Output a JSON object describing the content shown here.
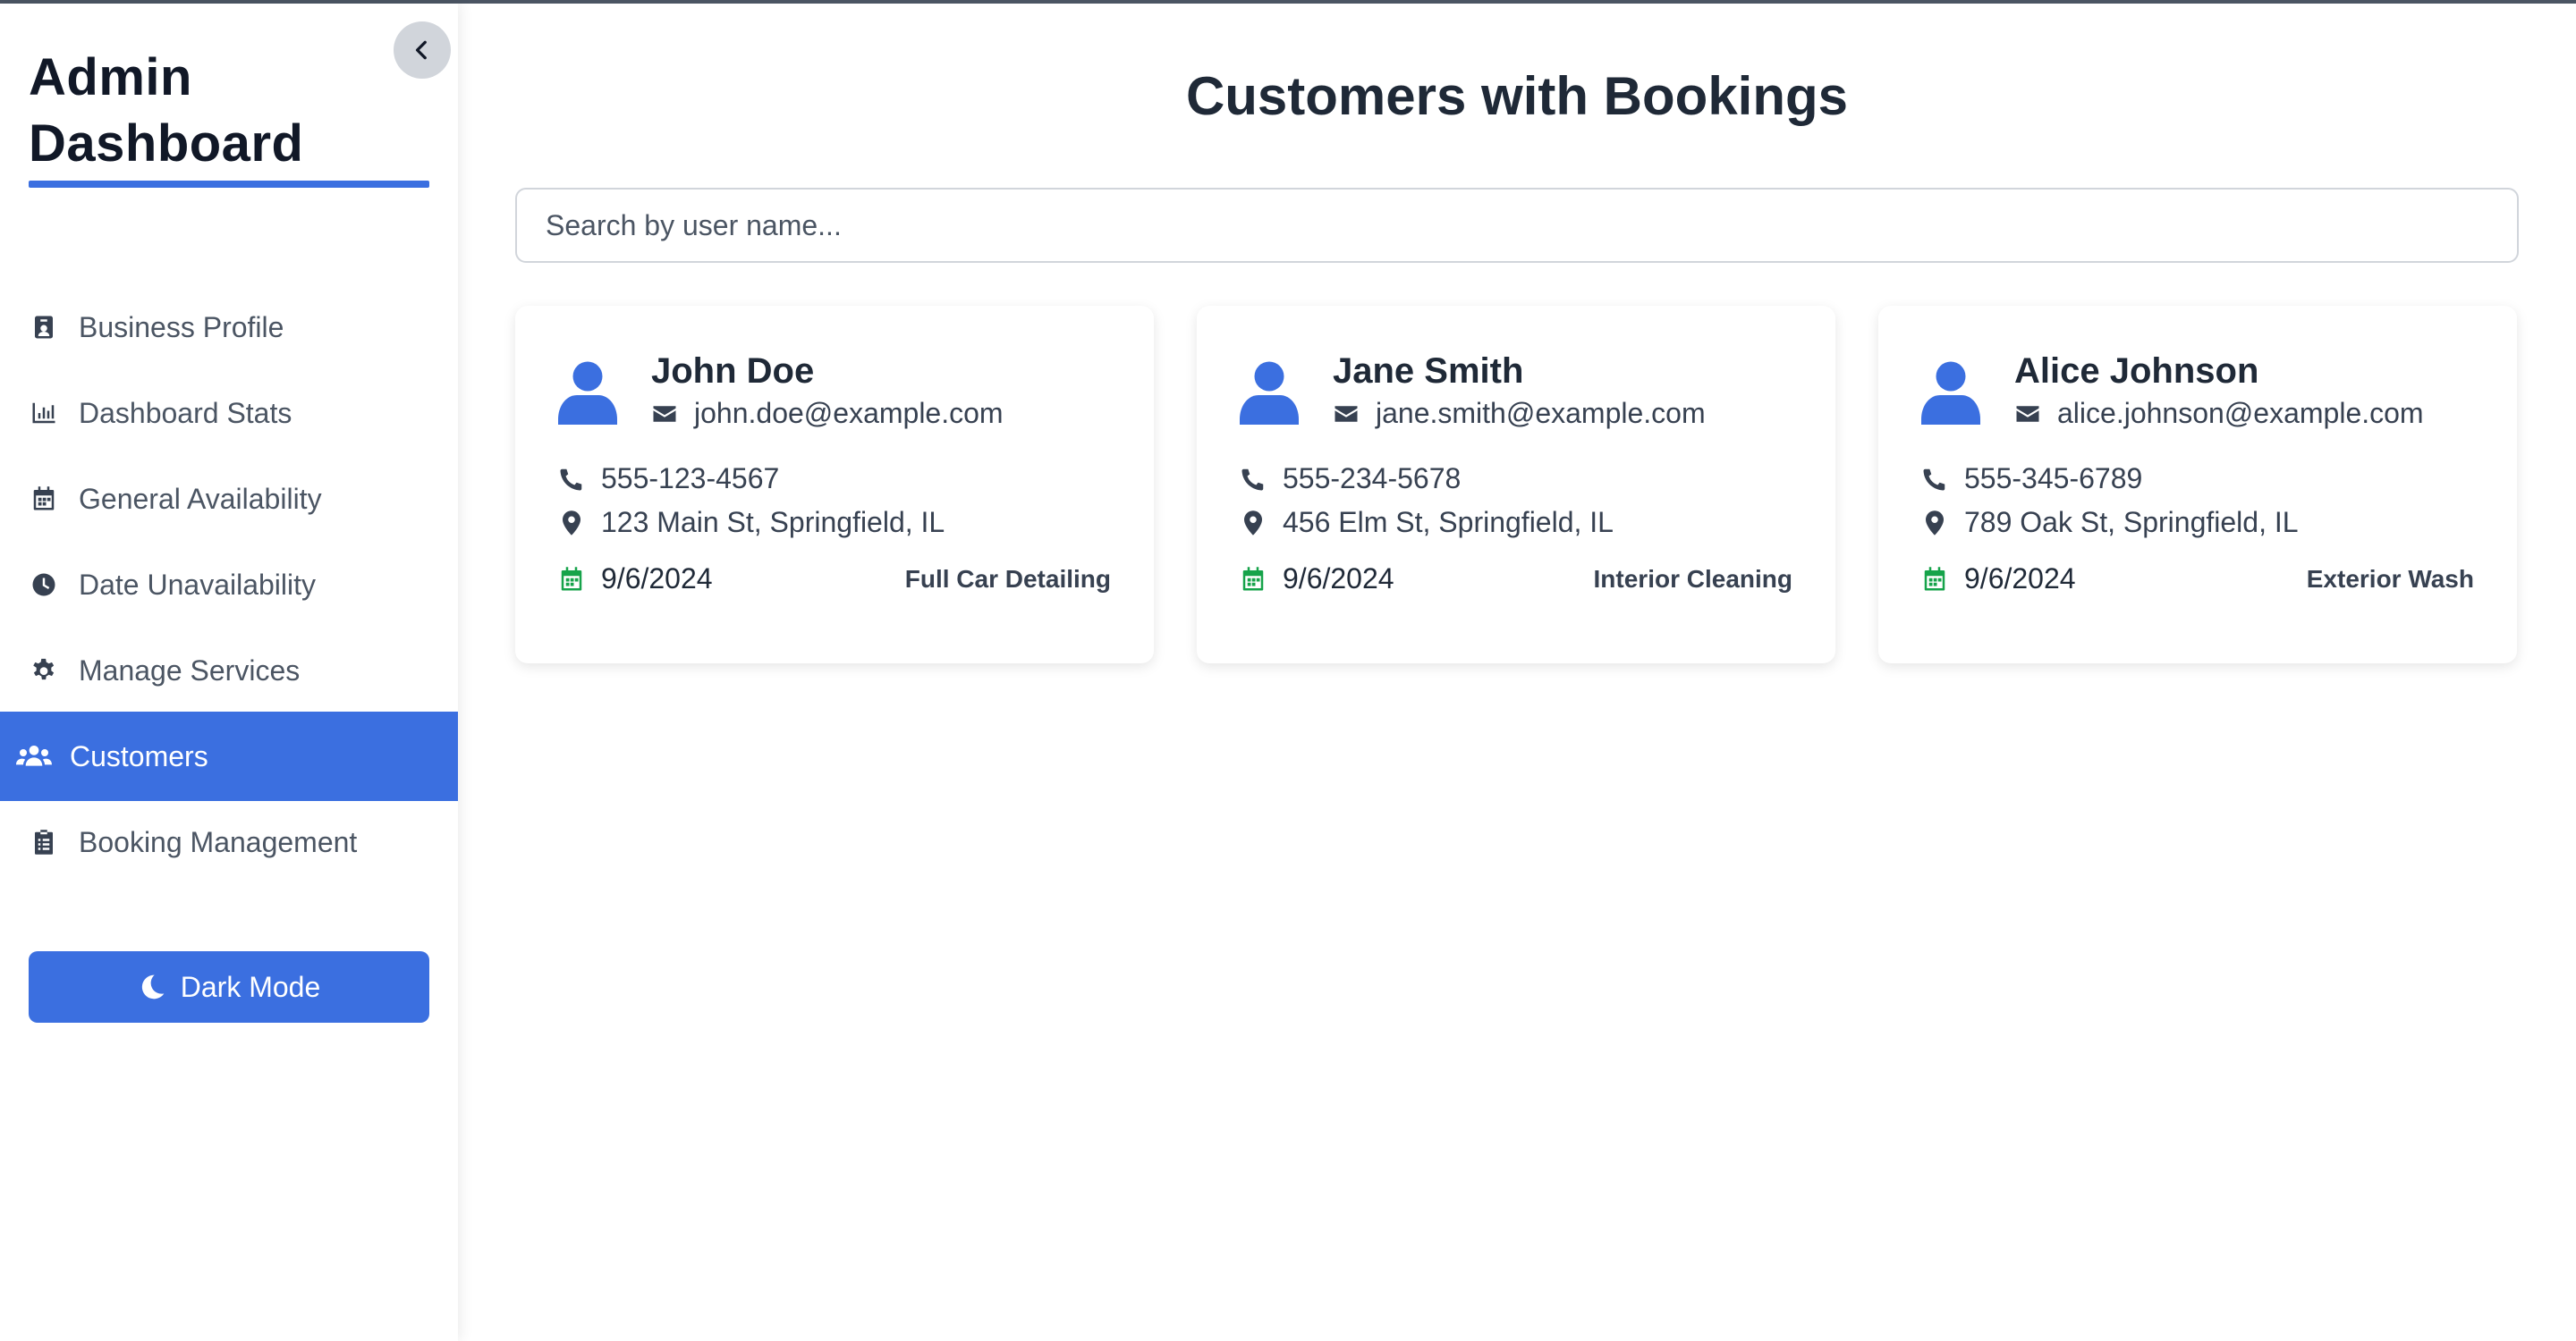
{
  "sidebar": {
    "brand_line1": "Admin",
    "brand_line2": "Dashboard",
    "items": [
      {
        "label": "Business Profile",
        "icon": "id-badge-icon"
      },
      {
        "label": "Dashboard Stats",
        "icon": "bar-chart-icon"
      },
      {
        "label": "General Availability",
        "icon": "calendar-icon"
      },
      {
        "label": "Date Unavailability",
        "icon": "clock-icon"
      },
      {
        "label": "Manage Services",
        "icon": "gear-icon"
      },
      {
        "label": "Customers",
        "icon": "users-icon",
        "active": true
      },
      {
        "label": "Booking Management",
        "icon": "clipboard-icon"
      }
    ],
    "dark_mode_label": "Dark Mode"
  },
  "main": {
    "title": "Customers with Bookings",
    "search_placeholder": "Search by user name..."
  },
  "customers": [
    {
      "name": "John Doe",
      "email": "john.doe@example.com",
      "phone": "555-123-4567",
      "address": "123 Main St, Springfield, IL",
      "date": "9/6/2024",
      "service": "Full Car Detailing"
    },
    {
      "name": "Jane Smith",
      "email": "jane.smith@example.com",
      "phone": "555-234-5678",
      "address": "456 Elm St, Springfield, IL",
      "date": "9/6/2024",
      "service": "Interior Cleaning"
    },
    {
      "name": "Alice Johnson",
      "email": "alice.johnson@example.com",
      "phone": "555-345-6789",
      "address": "789 Oak St, Springfield, IL",
      "date": "9/6/2024",
      "service": "Exterior Wash"
    }
  ],
  "colors": {
    "accent": "#3b6fe0",
    "calendar": "#16a34a",
    "text": "#1f2937"
  }
}
